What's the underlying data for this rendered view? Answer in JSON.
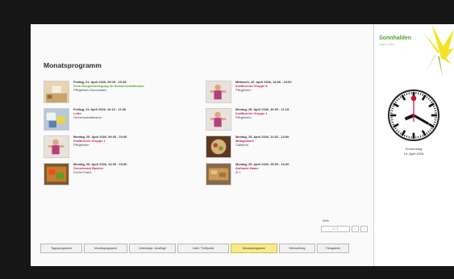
{
  "page": {
    "title": "Monatsprogramm"
  },
  "events": [
    {
      "date": "Freitag, 01. April 2026, 09:15 - 10:45",
      "name": "Grün Morgenbewegung im Gemeinschaftsraum",
      "place": "Pflegeheim Sonnhalden",
      "name_color": "#58a02c",
      "thumb": "room"
    },
    {
      "date": "Mittwoch, 20. April 2026, 14:00 - 15:00",
      "name": "Kraftturnier Gruppe 8",
      "place": "Pflegeheim",
      "name_color": "#d0245a",
      "thumb": "person"
    },
    {
      "date": "Freitag, 11. April 2026, 10:15 - 11:30",
      "name": "Lotto",
      "place": "Gemeinschaftsraum",
      "name_color": "#d0245a",
      "thumb": "cards"
    },
    {
      "date": "Montag, 25. April 2026, 10:00 - 11:15",
      "name": "Kraftturnier Gruppe 1",
      "place": "Pflegeheim",
      "name_color": "#d0245a",
      "thumb": "person"
    },
    {
      "date": "Montag, 25. April 2026, 09:30 - 10:30",
      "name": "Kraftturnier Gruppe 1",
      "place": "Pflegeheim",
      "name_color": "#d0245a",
      "thumb": "person"
    },
    {
      "date": "Montag, 25. April 2026, 11:30 - 13:00",
      "name": "Mittagstisch",
      "place": "Cafeteria",
      "name_color": "#d0245a",
      "thumb": "food"
    },
    {
      "date": "Montag, 25. April 2026, 14:30 - 15:30",
      "name": "Gemeinsam Backen",
      "place": "Küche Kraus",
      "name_color": "#d0245a",
      "thumb": "veg"
    },
    {
      "date": "Montag, 25. April 2026, 15:00 - 16:00",
      "name": "Aufbackt Haare",
      "place": "ZI 1",
      "name_color": "#d0245a",
      "thumb": "bread"
    }
  ],
  "pager": {
    "label": "Seite",
    "value": "1 / 1",
    "prev": "‹",
    "next": "›"
  },
  "nav": [
    {
      "label": "Tagesprogramm",
      "active": false
    },
    {
      "label": "Monatsprogramm",
      "active": false
    },
    {
      "label": "Unterwegs / Ausflüge",
      "active": false
    },
    {
      "label": "Café / Treffpunkt",
      "active": false
    },
    {
      "label": "Monatsprogramm",
      "active": true
    },
    {
      "label": "Heimzeitung",
      "active": false
    },
    {
      "label": "Fotogalerie",
      "active": false
    }
  ],
  "brand": {
    "name": "Sonnhalden",
    "tagline": "Leben im Alter"
  },
  "clock": {
    "day": "Donnerstag",
    "date": "14. April 2026"
  },
  "colors": {
    "accent_green": "#5aa028",
    "highlight": "#f6eb8c",
    "event_red": "#d0245a"
  }
}
